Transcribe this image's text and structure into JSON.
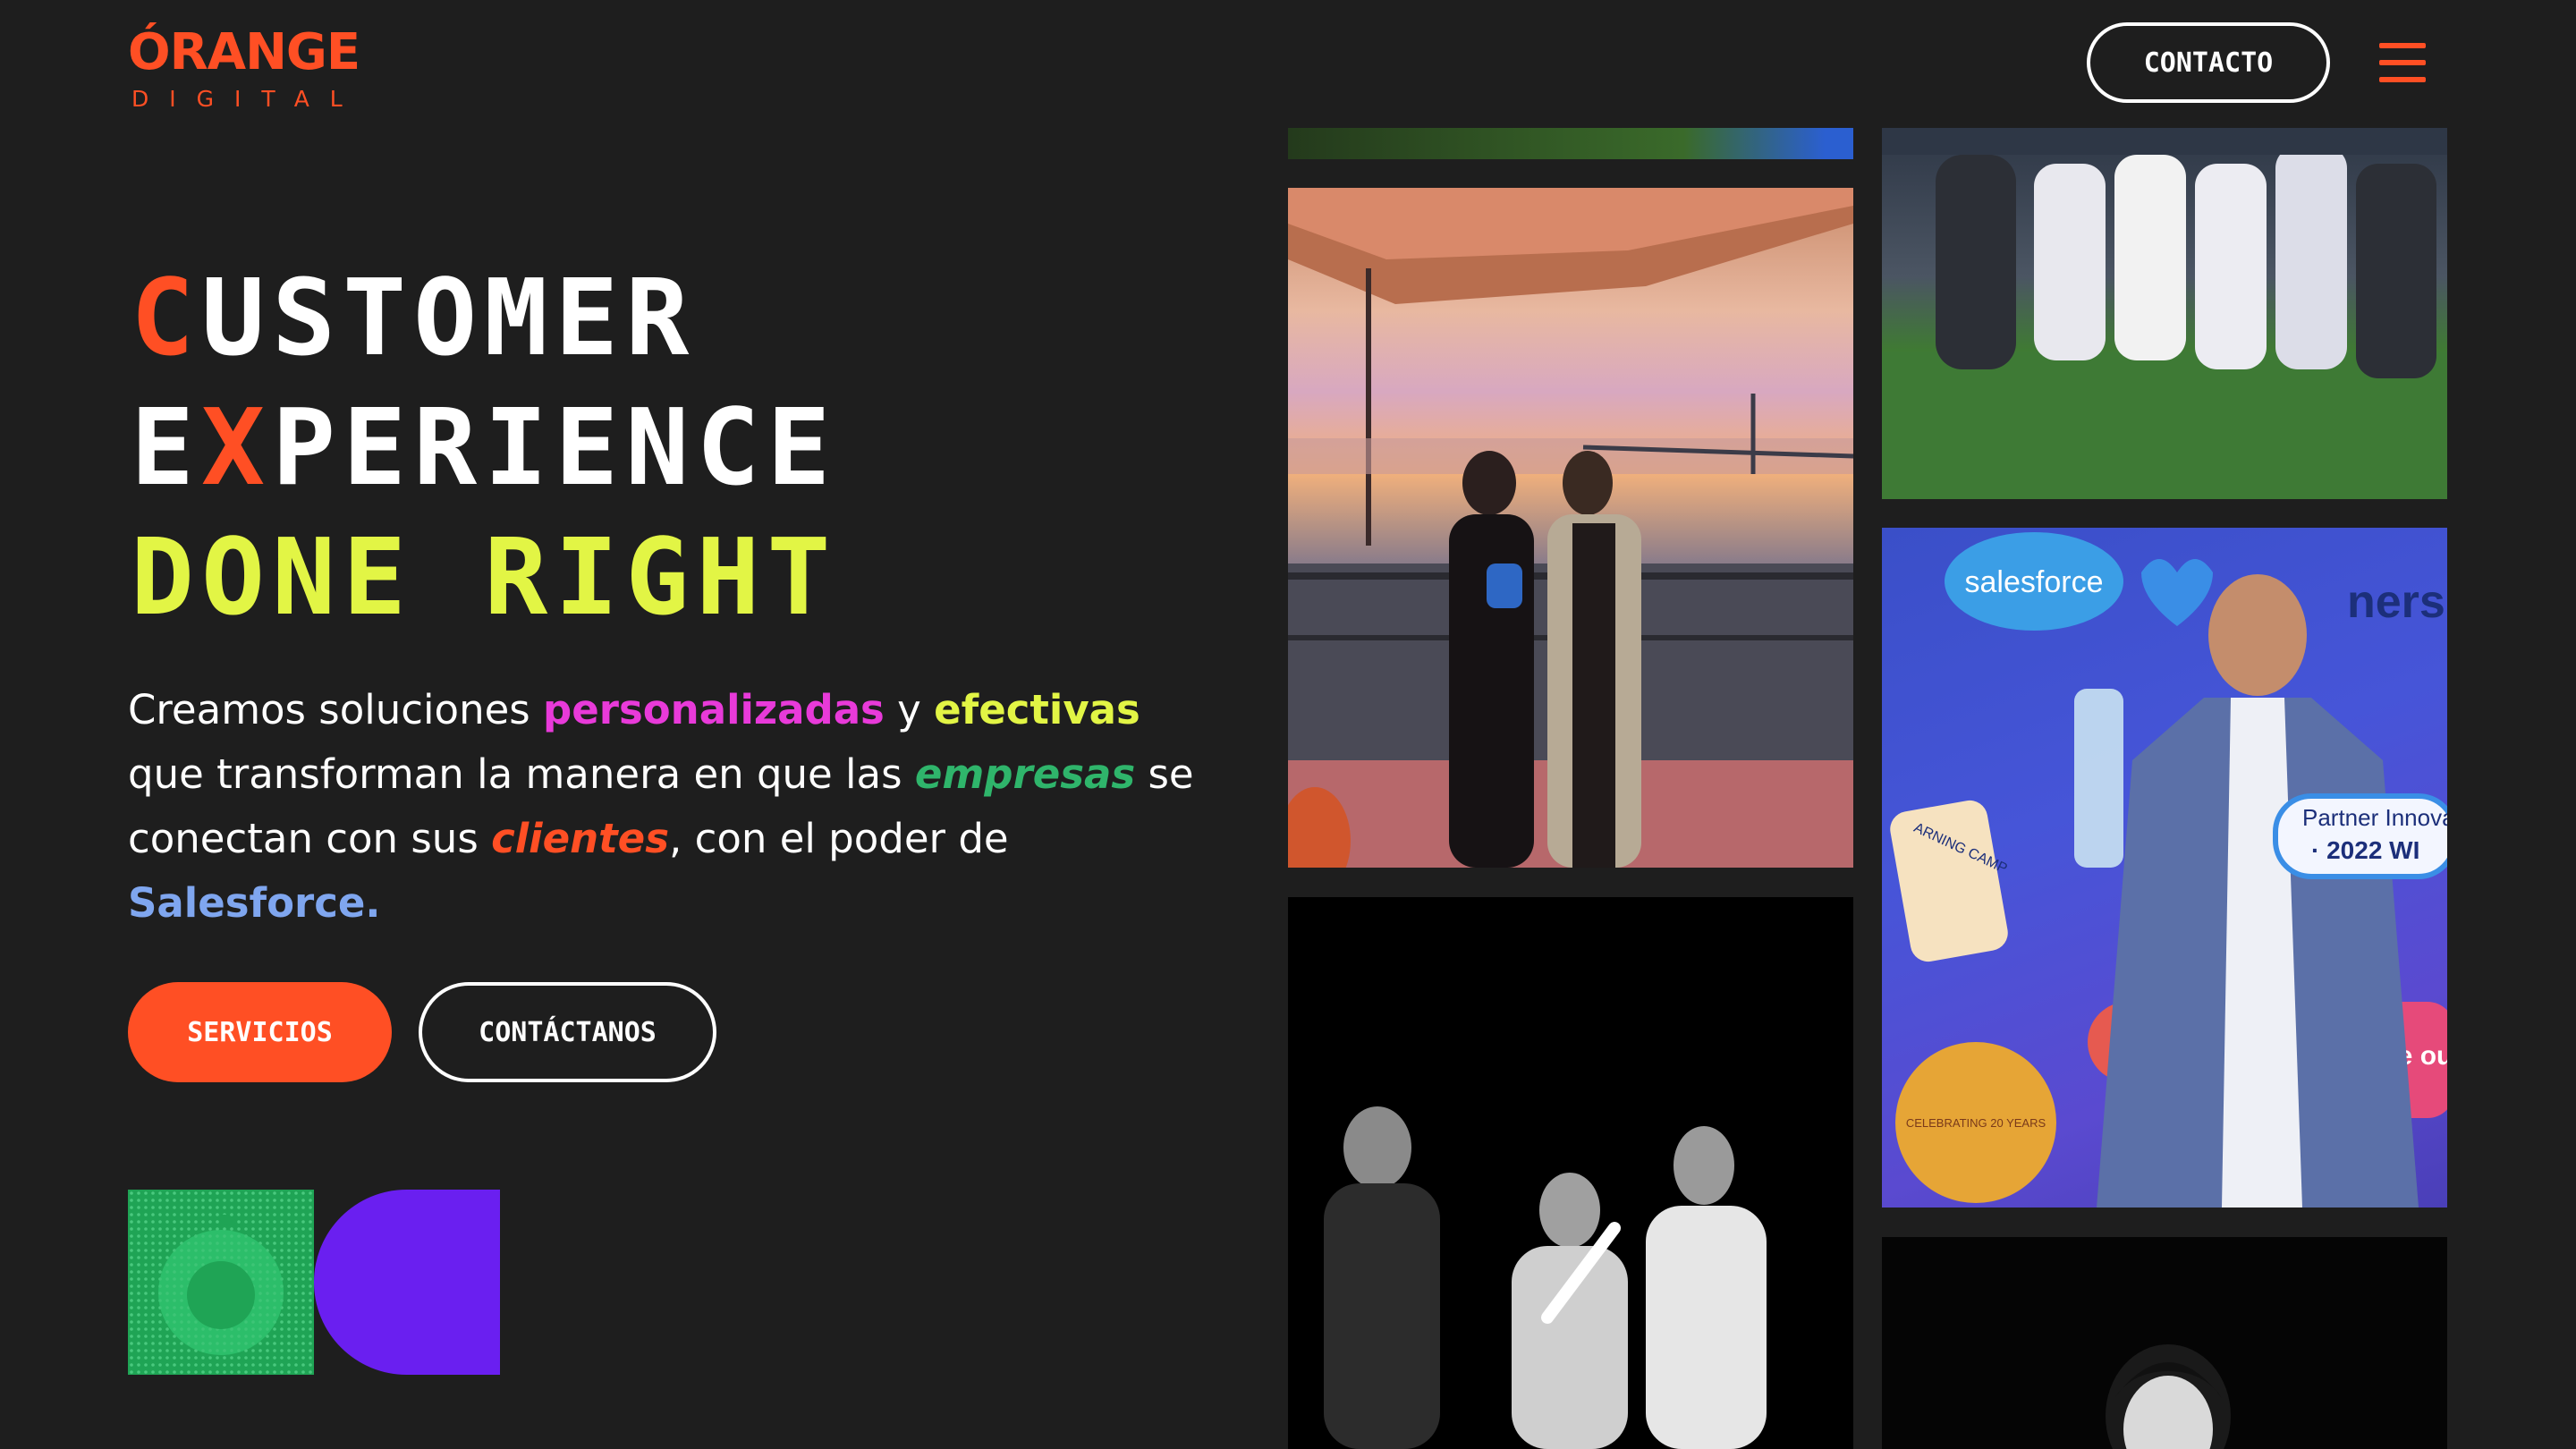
{
  "brand": {
    "name": "ÓRANGE",
    "sub": "DIGITAL",
    "color": "#ff4f24"
  },
  "header": {
    "contact_label": "CONTACTO",
    "menu_icon": "hamburger-menu-icon"
  },
  "hero": {
    "line1_accent": "C",
    "line1_rest": "USTOMER",
    "line2_start": "E",
    "line2_accent": "X",
    "line2_rest": "PERIENCE",
    "line3": "DONE RIGHT",
    "colors": {
      "white": "#ffffff",
      "accent": "#ff4f24",
      "lime": "#e2f545"
    }
  },
  "intro": {
    "t1": "Creamos soluciones ",
    "personalizadas": "personalizadas",
    "t2": " y ",
    "efectivas": "efectivas",
    "t3": " que transforman la manera en que las ",
    "empresas": "empresas",
    "t4": " se conectan con sus ",
    "clientes": "clientes",
    "t5": ", con el poder de ",
    "salesforce": "Salesforce",
    "t6": ".",
    "colors": {
      "personalizadas": "#e83ad9",
      "efectivas": "#e2f545",
      "empresas": "#2fb56b",
      "clientes": "#ff4f24",
      "salesforce": "#7fa6ef"
    }
  },
  "cta": {
    "primary_label": "SERVICIOS",
    "secondary_label": "CONTÁCTANOS"
  },
  "decor": {
    "green": "#1fa455",
    "purple": "#6a1ff0"
  },
  "gallery": {
    "salesforce_sign": "salesforce",
    "ners_fragment": "ners",
    "partner_badge_l1": "Partner Innova",
    "partner_badge_l2": "· 2022 WI",
    "trail_sticker": "aze our Trail",
    "learning_camp": "ARNING CAMP",
    "celebrating": "CELEBRATING 20 YEARS"
  }
}
